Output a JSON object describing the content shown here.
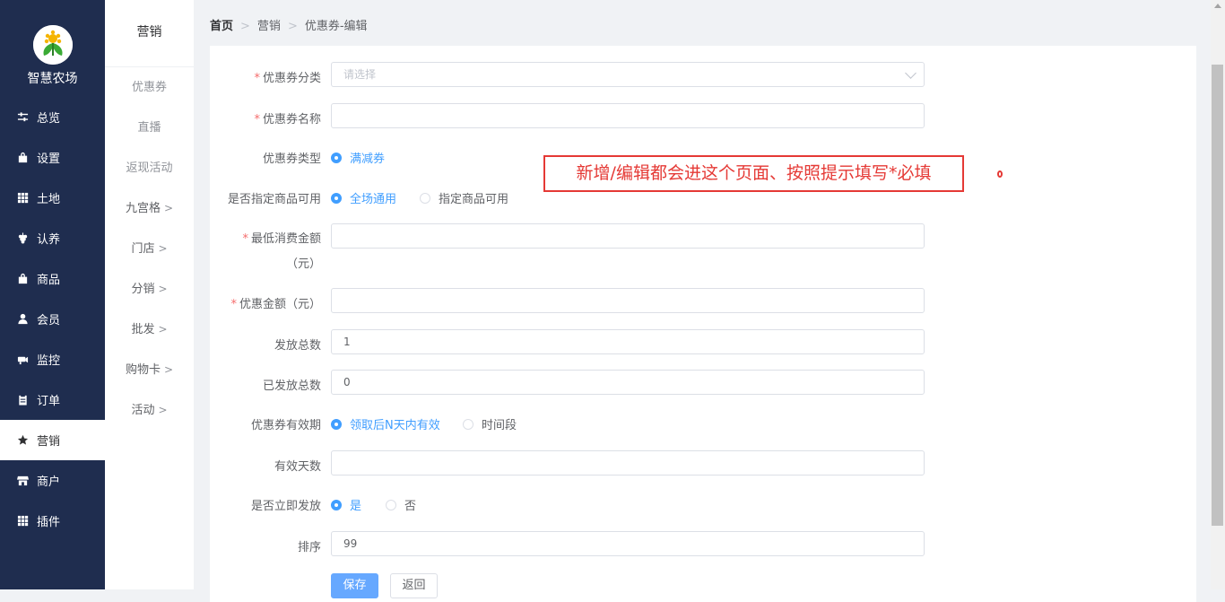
{
  "app": {
    "brand": "智慧农场"
  },
  "sidebar": {
    "items": [
      {
        "label": "总览",
        "icon": "sliders-icon"
      },
      {
        "label": "设置",
        "icon": "bag-icon"
      },
      {
        "label": "土地",
        "icon": "grid-icon"
      },
      {
        "label": "认养",
        "icon": "grape-icon"
      },
      {
        "label": "商品",
        "icon": "bag-icon"
      },
      {
        "label": "会员",
        "icon": "user-icon"
      },
      {
        "label": "监控",
        "icon": "camera-icon"
      },
      {
        "label": "订单",
        "icon": "clipboard-icon"
      },
      {
        "label": "营销",
        "icon": "star-icon",
        "active": true
      },
      {
        "label": "商户",
        "icon": "store-icon"
      },
      {
        "label": "插件",
        "icon": "grid-icon"
      }
    ]
  },
  "subbar": {
    "title": "营销",
    "items": [
      {
        "label": "优惠券"
      },
      {
        "label": "直播"
      },
      {
        "label": "返现活动"
      },
      {
        "label": "九宫格",
        "arrow": ">"
      },
      {
        "label": "门店",
        "arrow": ">"
      },
      {
        "label": "分销",
        "arrow": ">"
      },
      {
        "label": "批发",
        "arrow": ">"
      },
      {
        "label": "购物卡",
        "arrow": ">"
      },
      {
        "label": "活动",
        "arrow": ">"
      }
    ]
  },
  "breadcrumb": {
    "home": "首页",
    "level1": "营销",
    "level2": "优惠券-编辑",
    "sep": ">"
  },
  "form": {
    "category": {
      "label": "优惠券分类",
      "placeholder": "请选择"
    },
    "name": {
      "label": "优惠券名称",
      "value": ""
    },
    "type": {
      "label": "优惠券类型",
      "options": [
        "满减券"
      ]
    },
    "scope": {
      "label": "是否指定商品可用",
      "options": [
        "全场通用",
        "指定商品可用"
      ]
    },
    "min_amount": {
      "label": "最低消费金额",
      "label2": "（元）",
      "value": ""
    },
    "discount": {
      "label": "优惠金额（元）",
      "value": ""
    },
    "total": {
      "label": "发放总数",
      "value": "1"
    },
    "issued": {
      "label": "已发放总数",
      "value": "0"
    },
    "validity": {
      "label": "优惠券有效期",
      "options": [
        "领取后N天内有效",
        "时间段"
      ]
    },
    "days": {
      "label": "有效天数",
      "value": ""
    },
    "immediate": {
      "label": "是否立即发放",
      "options": [
        "是",
        "否"
      ]
    },
    "sort": {
      "label": "排序",
      "value": "99"
    },
    "required_mark": "*",
    "save": "保存",
    "back": "返回"
  },
  "annotation": {
    "text": "新增/编辑都会进这个页面、按照提示填写*必填"
  },
  "colors": {
    "sidebar": "#1f2d4f",
    "accent": "#409eff",
    "required": "#f56c6c",
    "annotation": "#e53935"
  }
}
